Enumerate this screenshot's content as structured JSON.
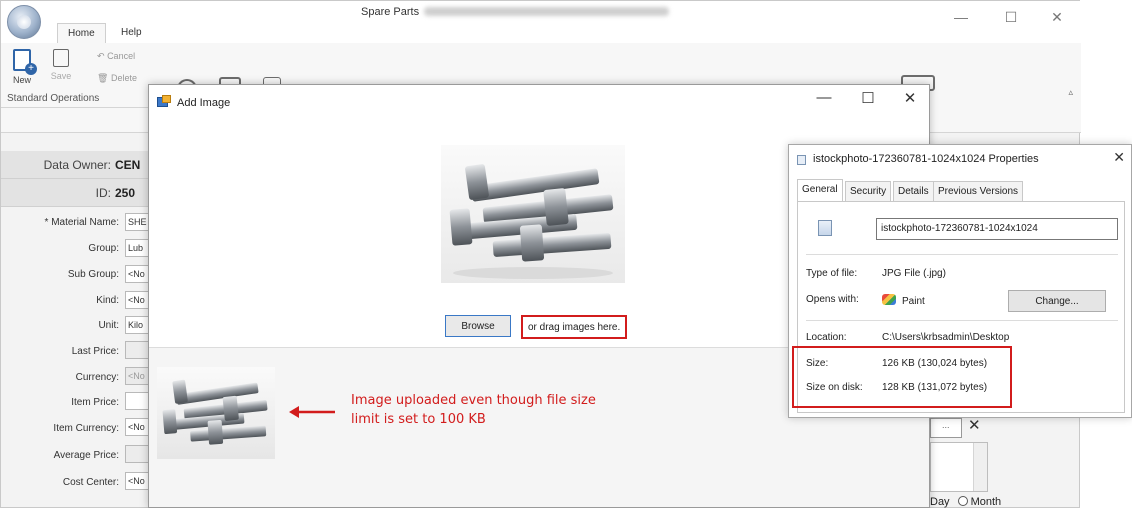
{
  "app": {
    "title": "Spare Parts",
    "tabs": [
      "Home",
      "Help"
    ],
    "ribbon": {
      "new_label": "New",
      "save_label": "Save",
      "cancel_label": "Cancel",
      "delete_label": "Delete",
      "group_label": "Standard Operations"
    },
    "form": {
      "data_owner_label": "Data Owner:",
      "data_owner_value": "CEN",
      "id_label": "ID:",
      "id_value": "250",
      "fields": [
        {
          "label": "* Material Name:",
          "value": "SHE"
        },
        {
          "label": "Group:",
          "value": "Lub"
        },
        {
          "label": "Sub Group:",
          "value": "<No"
        },
        {
          "label": "Kind:",
          "value": "<No"
        },
        {
          "label": "Unit:",
          "value": "Kilo"
        },
        {
          "label": "Last Price:",
          "value": ""
        },
        {
          "label": "Currency:",
          "value": "<No"
        },
        {
          "label": "Item Price:",
          "value": ""
        },
        {
          "label": "Item Currency:",
          "value": "<No"
        },
        {
          "label": "Average Price:",
          "value": ""
        },
        {
          "label": "Cost Center:",
          "value": "<No"
        }
      ]
    }
  },
  "add_image_dialog": {
    "title": "Add Image",
    "browse_label": "Browse",
    "drag_hint": "or drag images here."
  },
  "annotation": {
    "line1": "Image uploaded even though file size",
    "line2": "limit is set to 100 KB",
    "color": "#d21c1c"
  },
  "properties_dialog": {
    "title": "istockphoto-172360781-1024x1024 Properties",
    "tabs": [
      "General",
      "Security",
      "Details",
      "Previous Versions"
    ],
    "file_name": "istockphoto-172360781-1024x1024",
    "type_label": "Type of file:",
    "type_value": "JPG File (.jpg)",
    "opens_label": "Opens with:",
    "opens_value": "Paint",
    "change_label": "Change...",
    "location_label": "Location:",
    "location_value": "C:\\Users\\krbsadmin\\Desktop",
    "size_label": "Size:",
    "size_value": "126 KB (130,024 bytes)",
    "size_disk_label": "Size on disk:",
    "size_disk_value": "128 KB (131,072 bytes)"
  },
  "peek": {
    "ellipsis": "...",
    "radio_day": "Day",
    "radio_month": "Month"
  }
}
